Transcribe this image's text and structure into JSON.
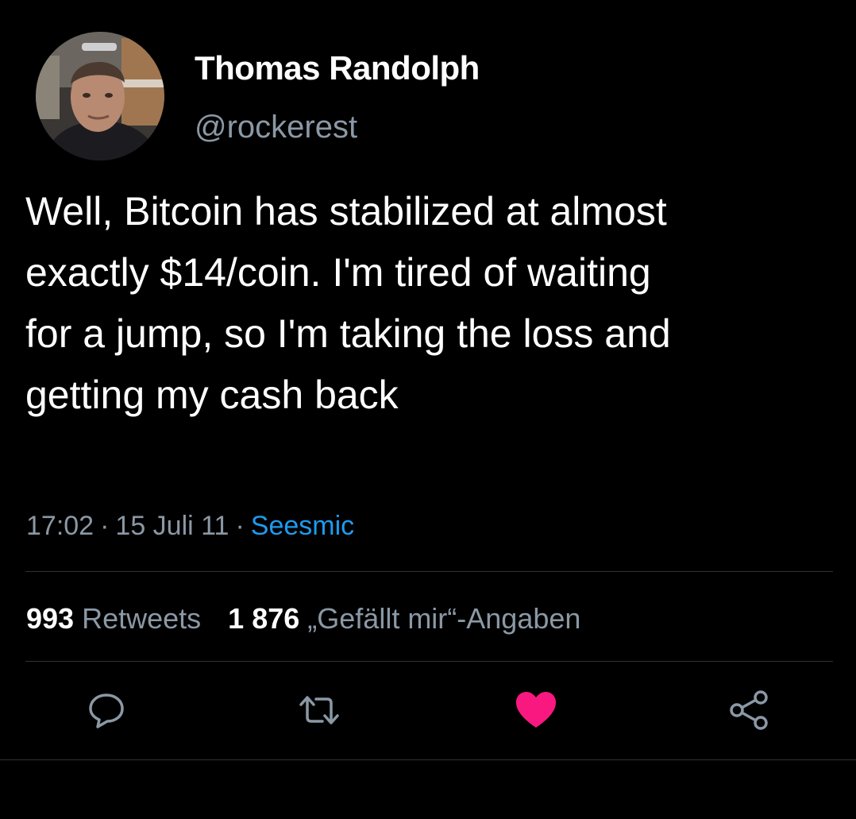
{
  "user": {
    "display_name": "Thomas Randolph",
    "handle": "@rockerest"
  },
  "tweet": {
    "text": "Well, Bitcoin has stabilized at almost\nexactly $14/coin.  I'm tired of waiting\nfor a jump, so I'm taking the loss and\ngetting my cash back",
    "time": "17:02",
    "separator": "·",
    "date": "15 Juli 11",
    "source": "Seesmic"
  },
  "stats": {
    "retweets_count": "993",
    "retweets_label": "Retweets",
    "likes_count": "1 876",
    "likes_label": "„Gefällt mir“-Angaben"
  },
  "actions": {
    "reply_icon": "speech-bubble-icon",
    "retweet_icon": "retweet-arrows-icon",
    "like_icon": "heart-icon",
    "share_icon": "share-nodes-icon"
  },
  "colors": {
    "background": "#000000",
    "text": "#ffffff",
    "secondary_text": "#8b98a5",
    "link": "#1d9bf0",
    "like": "#f91880",
    "divider": "#2f3336"
  }
}
